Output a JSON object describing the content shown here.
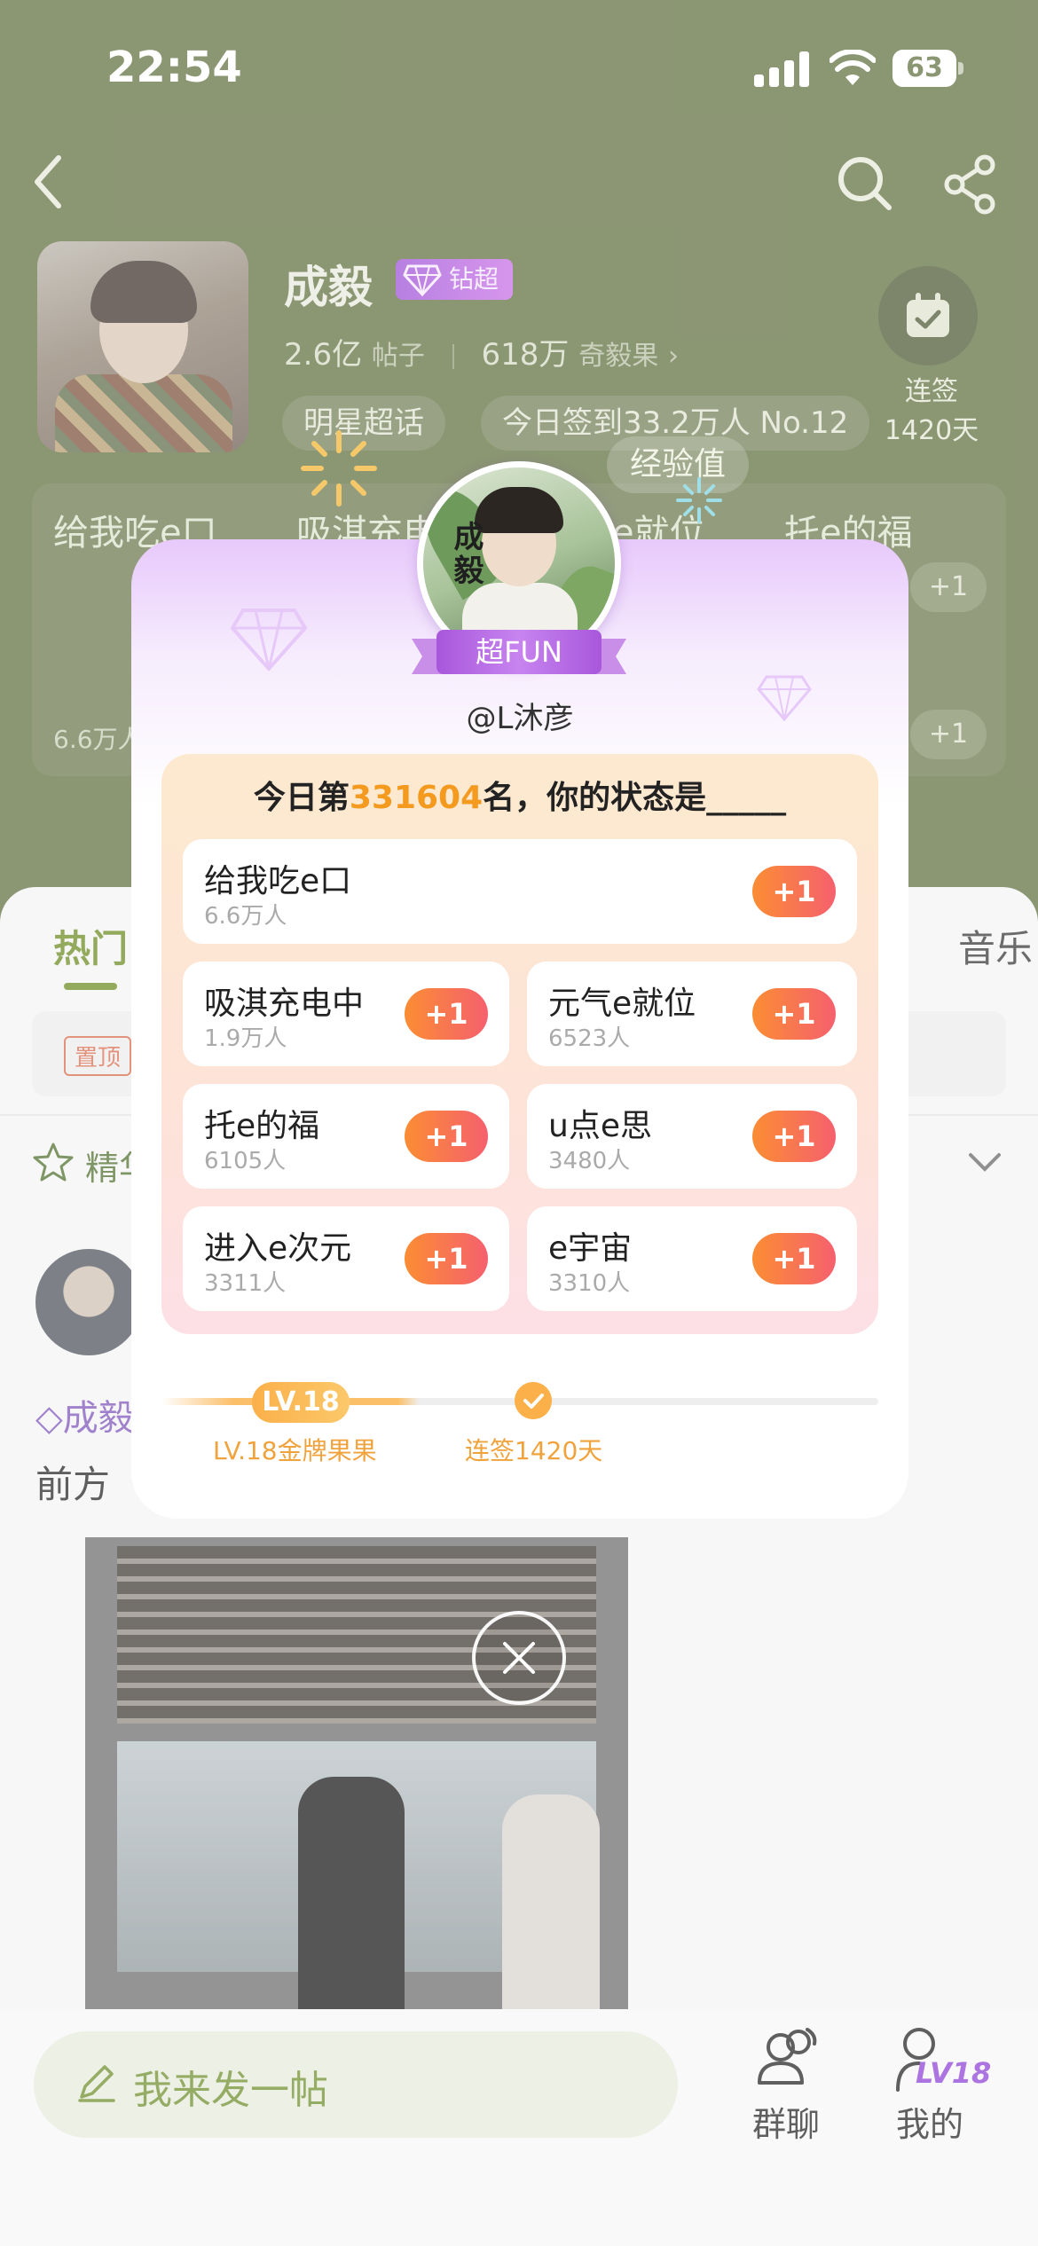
{
  "status_bar": {
    "time": "22:54",
    "battery": "63"
  },
  "header": {
    "star_name": "成毅",
    "badge": "钻超",
    "posts_value": "2.6亿",
    "posts_unit": "帖子",
    "fans_value": "618万",
    "fans_unit": "奇毅果",
    "fans_chevron": "›",
    "chip_star": "明星超话",
    "chip_checkin": "今日签到33.2万人 No.12",
    "checkin_label_1": "连签",
    "checkin_label_2": "1420天"
  },
  "background_cards": {
    "card1": "给我吃e口",
    "card2": "吸淇充电",
    "card3": "e就位",
    "card4": "托e的福",
    "exp_tag": "经验值",
    "plus": "+1",
    "count": "6.6万人"
  },
  "tabs": {
    "hot": "热门",
    "music": "音乐"
  },
  "pinned": {
    "tag": "置顶"
  },
  "featured": {
    "label": "精华"
  },
  "post": {
    "tag": "成毅",
    "text": "前方"
  },
  "bottom_bar": {
    "compose_placeholder": "我来发一帖",
    "group_chat": "群聊",
    "mine": "我的",
    "mine_level": "LV18"
  },
  "modal": {
    "avatar_calligraphy": "成毅",
    "ribbon": "超FUN",
    "username": "@L沐彦",
    "title_prefix": "今日第",
    "rank": "331604",
    "title_suffix": "名，你的状态是_____",
    "options": [
      {
        "name": "给我吃e口",
        "count": "6.6万人",
        "action": "+1"
      },
      {
        "name": "吸淇充电中",
        "count": "1.9万人",
        "action": "+1"
      },
      {
        "name": "元气e就位",
        "count": "6523人",
        "action": "+1"
      },
      {
        "name": "托e的福",
        "count": "6105人",
        "action": "+1"
      },
      {
        "name": "u点e思",
        "count": "3480人",
        "action": "+1"
      },
      {
        "name": "进入e次元",
        "count": "3311人",
        "action": "+1"
      },
      {
        "name": "e宇宙",
        "count": "3310人",
        "action": "+1"
      }
    ],
    "level_pill": "LV.18",
    "level_caption": "LV.18金牌果果",
    "streak_caption": "连签1420天",
    "colors": {
      "accent_orange": "#f39a1f",
      "button_gradient_start": "#fb8d34",
      "button_gradient_end": "#f5606e",
      "ribbon_purple": "#a857db"
    }
  }
}
